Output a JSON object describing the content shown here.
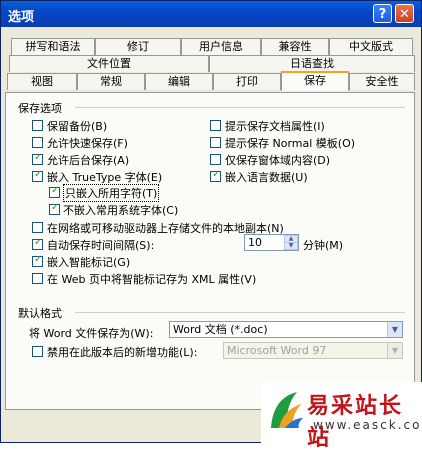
{
  "window": {
    "title": "选项",
    "help_label": "?",
    "close_label": "✕"
  },
  "tabs_row1": [
    "拼写和语法",
    "修订",
    "用户信息",
    "兼容性",
    "中文版式"
  ],
  "tabs_row2": [
    "文件位置",
    "日语查找"
  ],
  "tabs_row3": [
    "视图",
    "常规",
    "编辑",
    "打印",
    "保存",
    "安全性"
  ],
  "active_tab": "保存",
  "save_options": {
    "group_label": "保存选项",
    "items": [
      {
        "label": "保留备份(B)",
        "checked": false
      },
      {
        "label": "允许快速保存(F)",
        "checked": false
      },
      {
        "label": "允许后台保存(A)",
        "checked": true
      },
      {
        "label": "嵌入 TrueType 字体(E)",
        "checked": true
      },
      {
        "label": "只嵌入所用字符(T)",
        "checked": true
      },
      {
        "label": "不嵌入常用系统字体(C)",
        "checked": true
      },
      {
        "label": "提示保存文档属性(I)",
        "checked": false
      },
      {
        "label": "提示保存 Normal 模板(O)",
        "checked": false
      },
      {
        "label": "仅保存窗体域内容(D)",
        "checked": false
      },
      {
        "label": "嵌入语言数据(U)",
        "checked": true
      },
      {
        "label": "在网络或可移动驱动器上存储文件的本地副本(N)",
        "checked": false
      },
      {
        "label": "自动保存时间间隔(S):",
        "checked": true
      },
      {
        "label": "嵌入智能标记(G)",
        "checked": true
      },
      {
        "label": "在 Web 页中将智能标记存为 XML 属性(V)",
        "checked": false
      }
    ],
    "autosave_value": "10",
    "autosave_unit": "分钟(M)"
  },
  "default_format": {
    "group_label": "默认格式",
    "save_as_label": "将 Word 文件保存为(W):",
    "save_as_value": "Word 文档 (*.doc)",
    "disable_label": "禁用在此版本后的新增功能(L):",
    "disable_value": "Microsoft Word 97"
  },
  "buttons": {
    "ok_partial": "确"
  },
  "watermark": {
    "text": "易采站长站",
    "url": "www.easck.com"
  }
}
